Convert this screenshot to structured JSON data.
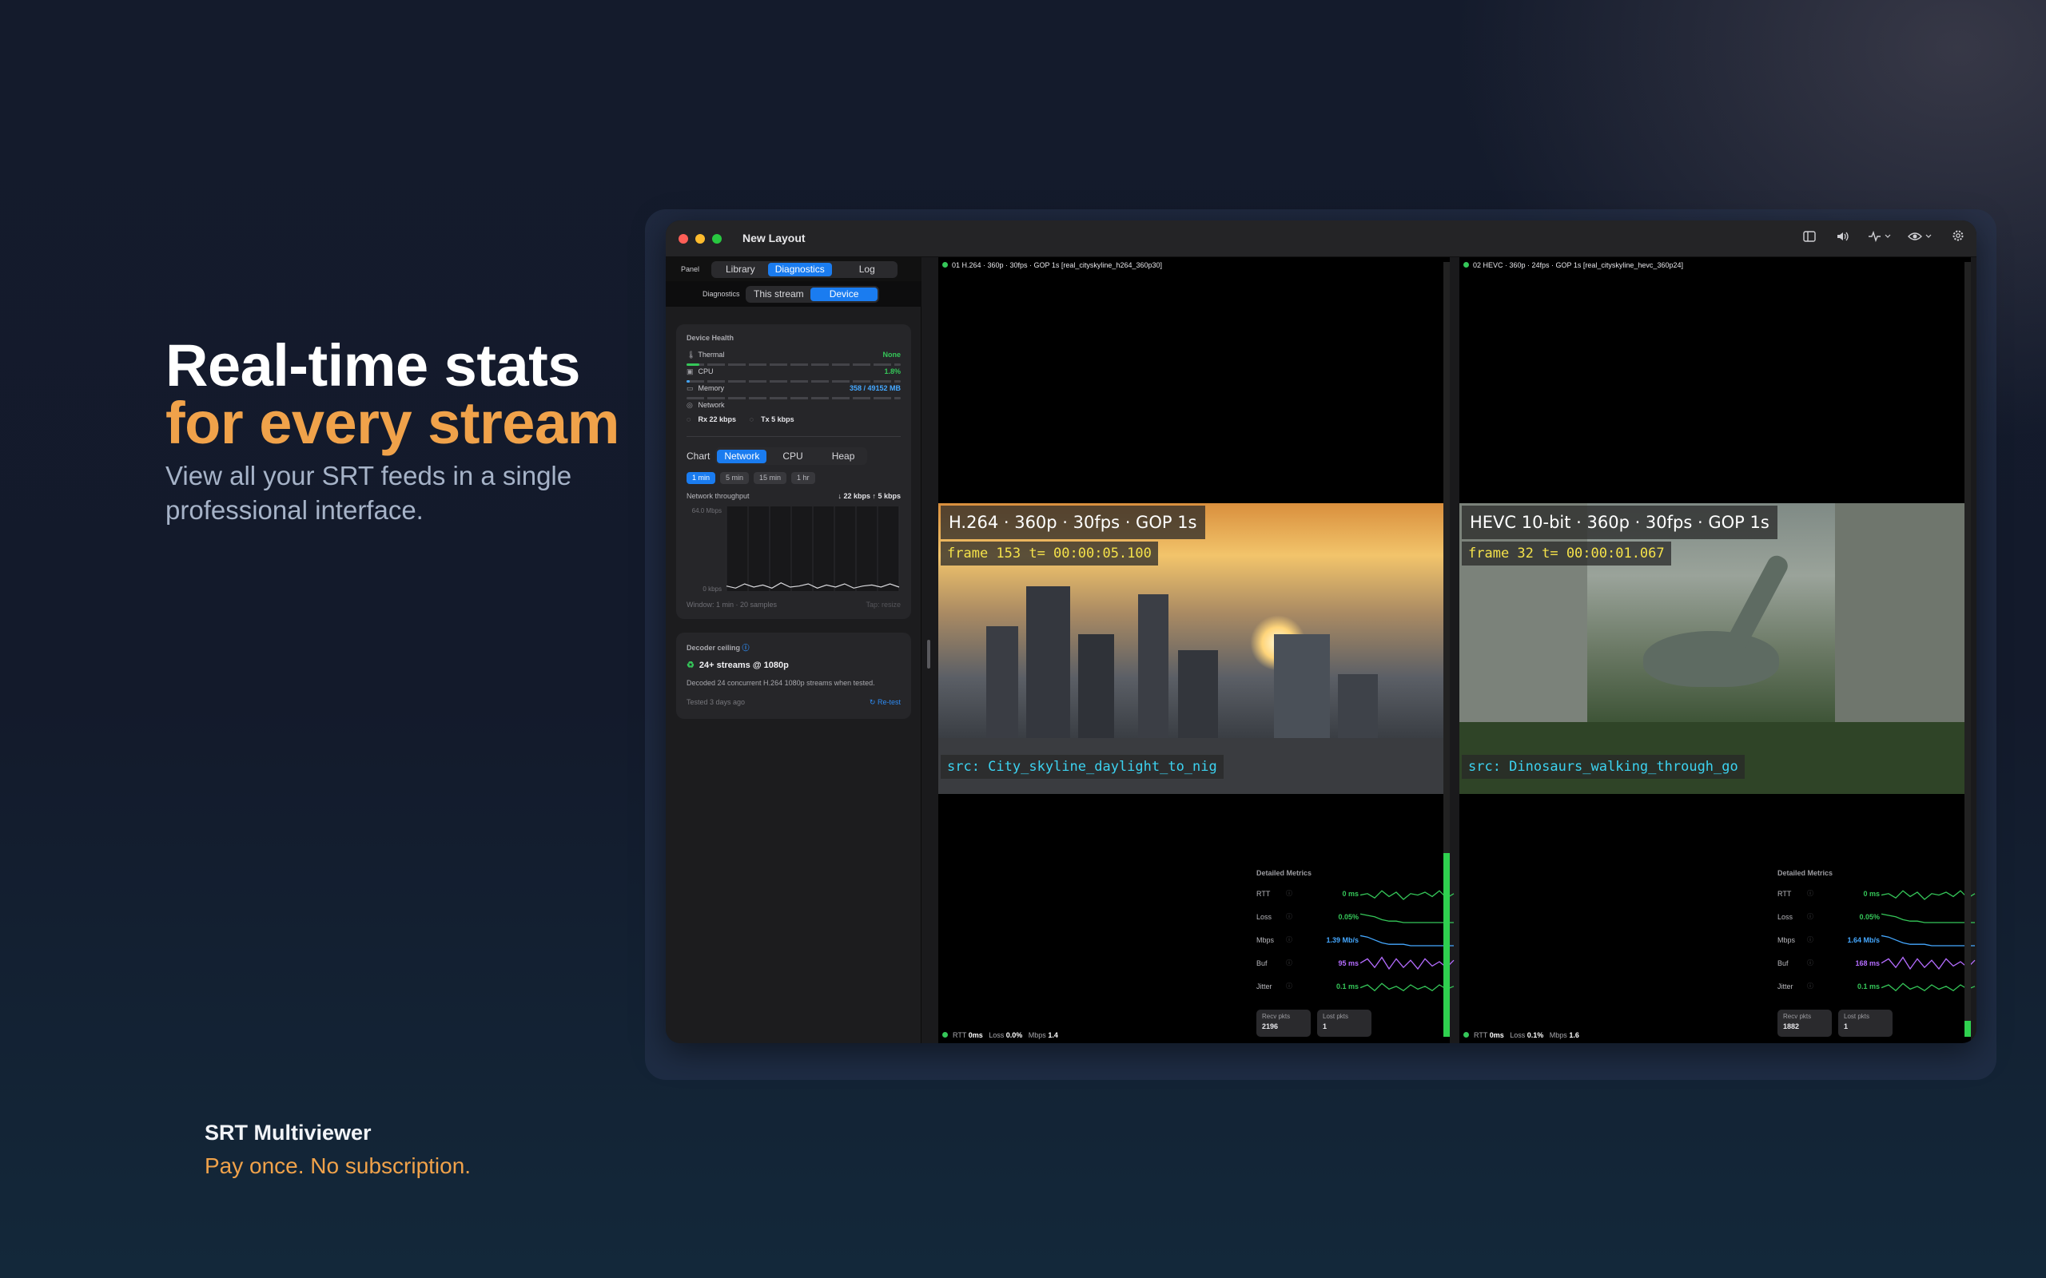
{
  "hero": {
    "line1": "Real-time stats",
    "line2": "for every stream",
    "subtitle": "View all your SRT feeds in a single professional interface."
  },
  "brand": {
    "name": "SRT Multiviewer",
    "tagline": "Pay once. No subscription."
  },
  "window": {
    "title": "New Layout",
    "toolbar_icons": [
      "sidebar-icon",
      "speaker-icon",
      "activity-icon",
      "eye-icon",
      "gear-icon"
    ]
  },
  "sidebar": {
    "panel_label": "Panel",
    "panel_tabs": [
      "Library",
      "Diagnostics",
      "Log"
    ],
    "panel_selected": "Diagnostics",
    "diag_label": "Diagnostics",
    "diag_tabs": [
      "This stream",
      "Device"
    ],
    "diag_selected": "Device",
    "device_health": {
      "title": "Device Health",
      "thermal": {
        "label": "Thermal",
        "value": "None"
      },
      "cpu": {
        "label": "CPU",
        "value": "1.8%",
        "fraction": 0.06
      },
      "memory": {
        "label": "Memory",
        "value": "358 / 49152 MB",
        "fraction": 0.01
      },
      "network": {
        "label": "Network",
        "rx": "Rx 22 kbps",
        "tx": "Tx 5 kbps"
      }
    },
    "chart": {
      "label": "Chart",
      "tabs": [
        "Network",
        "CPU",
        "Heap"
      ],
      "selected": "Network",
      "ranges": [
        "1 min",
        "5 min",
        "15 min",
        "1 hr"
      ],
      "range_selected": "1 min",
      "throughput_label": "Network throughput",
      "throughput_rate": "↓ 22 kbps  ↑ 5 kbps",
      "y_top": "64.0 Mbps",
      "y_bottom": "0 kbps",
      "footer_left": "Window: 1 min · 20 samples",
      "footer_right": "Tap: resize"
    },
    "decoder": {
      "title": "Decoder ceiling",
      "main": "24+ streams @ 1080p",
      "desc": "Decoded 24 concurrent H.264 1080p streams when tested.",
      "tested": "Tested 3 days ago",
      "retest": "Re-test"
    }
  },
  "chart_data": {
    "type": "line",
    "title": "Network throughput",
    "ylim": [
      0,
      64
    ],
    "ylabel": "Mbps",
    "series": [
      {
        "name": "Network",
        "values": [
          0.4,
          0.2,
          0.6,
          0.3,
          0.5,
          0.2,
          0.7,
          0.3,
          0.4,
          0.6,
          0.2,
          0.5,
          0.3,
          0.6,
          0.2,
          0.4,
          0.5,
          0.3,
          0.6,
          0.3
        ]
      }
    ]
  },
  "streams": [
    {
      "header": "01 H.264 · 360p · 30fps · GOP 1s  [real_cityskyline_h264_360p30]",
      "codec": "H.264 · 360p · 30fps · GOP 1s",
      "frame": "frame 153  t= 00:00:05.100",
      "src": "src: City_skyline_daylight_to_nig",
      "metrics": {
        "title": "Detailed Metrics",
        "rows": [
          {
            "k": "RTT",
            "v": "0 ms",
            "color": "#35c759"
          },
          {
            "k": "Loss",
            "v": "0.05%",
            "color": "#35c759"
          },
          {
            "k": "Mbps",
            "v": "1.39 Mb/s",
            "color": "#45a8ff"
          },
          {
            "k": "Buf",
            "v": "95 ms",
            "color": "#b46cff"
          },
          {
            "k": "Jitter",
            "v": "0.1 ms",
            "color": "#35c759"
          }
        ],
        "recv_label": "Recv pkts",
        "recv": "2196",
        "lost_label": "Lost pkts",
        "lost": "1"
      },
      "foot": {
        "rtt": "0ms",
        "loss": "0.0%",
        "mbps": "1.4"
      }
    },
    {
      "header": "02 HEVC · 360p · 24fps · GOP 1s  [real_cityskyline_hevc_360p24]",
      "codec": "HEVC 10-bit · 360p · 30fps · GOP 1s",
      "frame": "frame 32  t= 00:00:01.067",
      "src": "src: Dinosaurs_walking_through_go",
      "metrics": {
        "title": "Detailed Metrics",
        "rows": [
          {
            "k": "RTT",
            "v": "0 ms",
            "color": "#35c759"
          },
          {
            "k": "Loss",
            "v": "0.05%",
            "color": "#35c759"
          },
          {
            "k": "Mbps",
            "v": "1.64 Mb/s",
            "color": "#45a8ff"
          },
          {
            "k": "Buf",
            "v": "168 ms",
            "color": "#b46cff"
          },
          {
            "k": "Jitter",
            "v": "0.1 ms",
            "color": "#35c759"
          }
        ],
        "recv_label": "Recv pkts",
        "recv": "1882",
        "lost_label": "Lost pkts",
        "lost": "1"
      },
      "foot": {
        "rtt": "0ms",
        "loss": "0.1%",
        "mbps": "1.6"
      }
    }
  ],
  "footer_labels": {
    "rtt": "RTT",
    "loss": "Loss",
    "mbps": "Mbps"
  }
}
